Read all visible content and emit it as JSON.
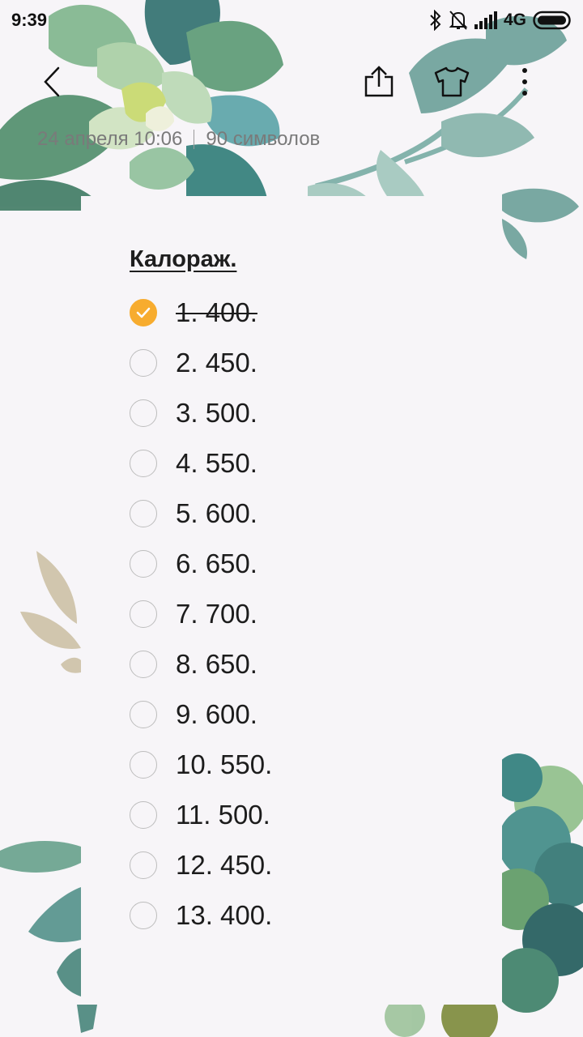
{
  "status_bar": {
    "time": "9:39",
    "network": "4G",
    "icons": [
      "bluetooth-icon",
      "bell-muted-icon",
      "signal-icon",
      "battery-icon"
    ]
  },
  "toolbar": {
    "icons": [
      "back-icon",
      "share-icon",
      "theme-shirt-icon",
      "more-icon"
    ]
  },
  "note_meta": {
    "date": "24 апреля 10:06",
    "chars": "90 символов"
  },
  "note": {
    "title": "Калораж.",
    "items": [
      {
        "text": "1. 400.",
        "checked": true
      },
      {
        "text": "2. 450.",
        "checked": false
      },
      {
        "text": "3. 500.",
        "checked": false
      },
      {
        "text": "4. 550.",
        "checked": false
      },
      {
        "text": "5. 600.",
        "checked": false
      },
      {
        "text": "6. 650.",
        "checked": false
      },
      {
        "text": "7. 700.",
        "checked": false
      },
      {
        "text": "8. 650.",
        "checked": false
      },
      {
        "text": "9. 600.",
        "checked": false
      },
      {
        "text": "10. 550.",
        "checked": false
      },
      {
        "text": "11. 500.",
        "checked": false
      },
      {
        "text": "12. 450.",
        "checked": false
      },
      {
        "text": "13. 400.",
        "checked": false
      }
    ]
  },
  "colors": {
    "accent": "#f7ac2f",
    "background": "#f7f5f8"
  }
}
